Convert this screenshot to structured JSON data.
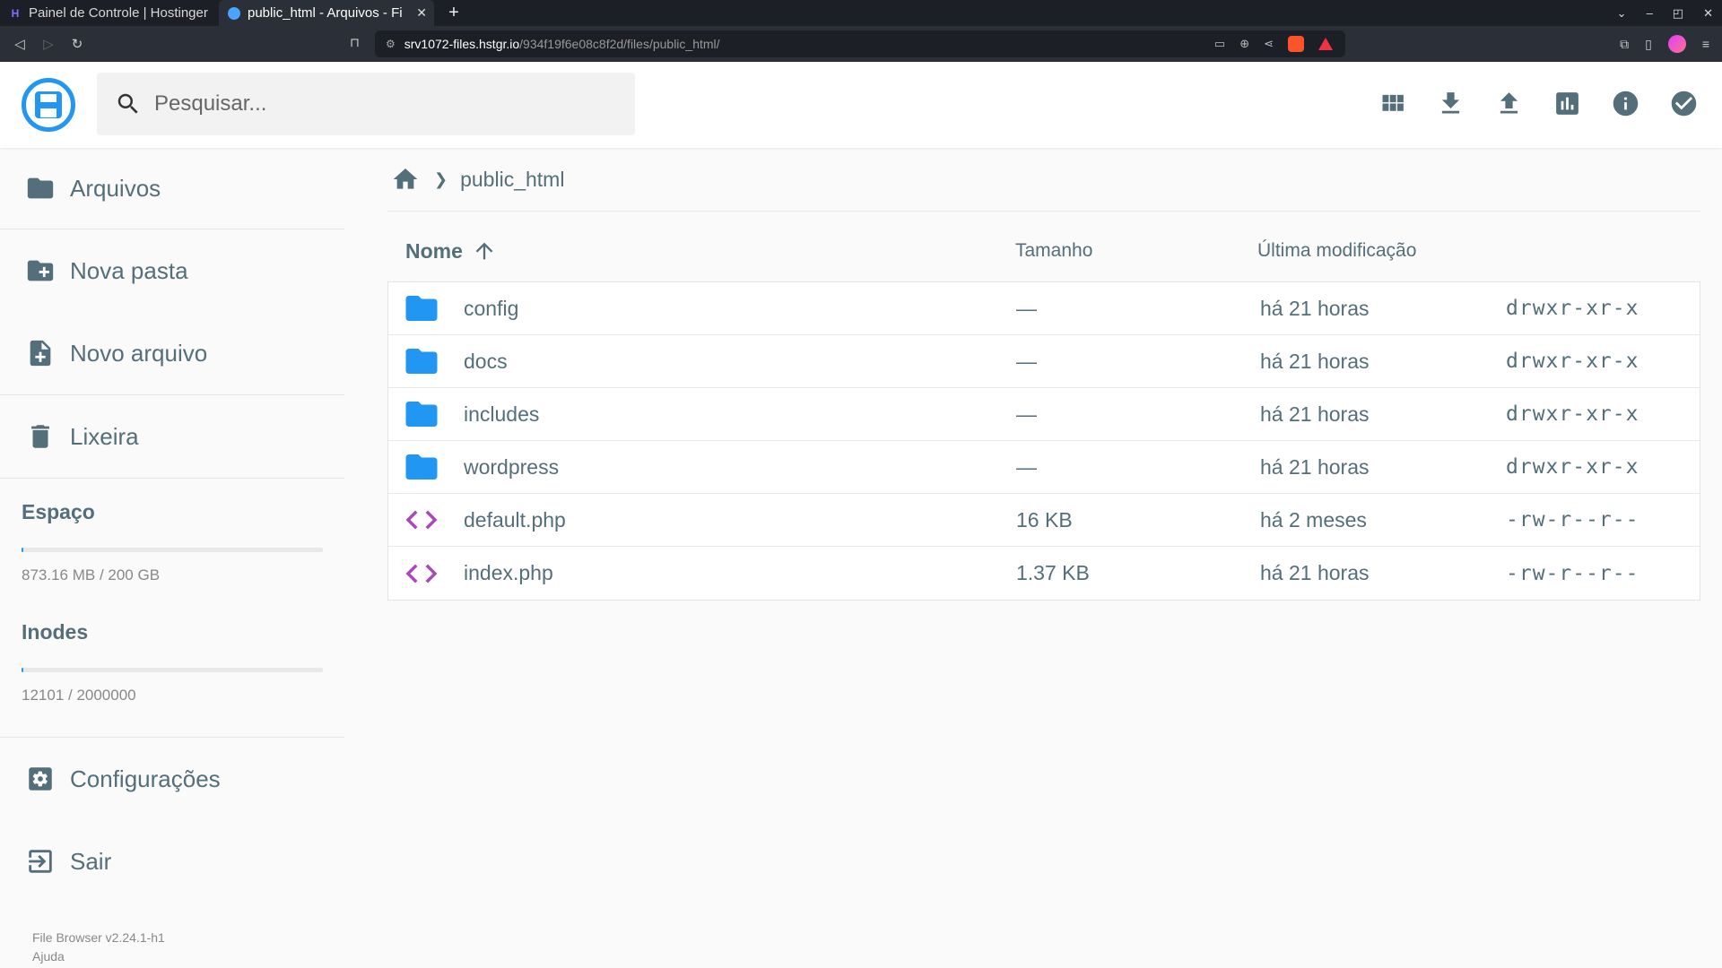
{
  "browser": {
    "tabs": [
      {
        "title": "Painel de Controle | Hostinger",
        "active": false
      },
      {
        "title": "public_html - Arquivos - Fi",
        "active": true
      }
    ],
    "url_host": "srv1072-files.hstgr.io",
    "url_path": "/934f19f6e08c8f2d/files/public_html/"
  },
  "header": {
    "search_placeholder": "Pesquisar...",
    "actions": [
      "grid-view-icon",
      "download-icon",
      "upload-icon",
      "disk-usage-icon",
      "info-icon",
      "select-multiple-icon"
    ]
  },
  "sidebar": {
    "items": [
      {
        "label": "Arquivos",
        "icon": "folder-icon"
      },
      {
        "label": "Nova pasta",
        "icon": "create-folder-icon"
      },
      {
        "label": "Novo arquivo",
        "icon": "new-file-icon"
      },
      {
        "label": "Lixeira",
        "icon": "trash-icon"
      }
    ],
    "space_label": "Espaço",
    "space_value": "873.16 MB / 200 GB",
    "space_fraction": 0.004,
    "inodes_label": "Inodes",
    "inodes_value": "12101 / 2000000",
    "inodes_fraction": 0.006,
    "settings_label": "Configurações",
    "logout_label": "Sair",
    "version": "File Browser v2.24.1-h1",
    "help": "Ajuda"
  },
  "breadcrumb": {
    "current": "public_html"
  },
  "listing": {
    "headers": {
      "name": "Nome",
      "size": "Tamanho",
      "modified": "Última modificação"
    },
    "rows": [
      {
        "name": "config",
        "size": "—",
        "modified": "há 21 horas",
        "perm": "drwxr-xr-x",
        "type": "folder"
      },
      {
        "name": "docs",
        "size": "—",
        "modified": "há 21 horas",
        "perm": "drwxr-xr-x",
        "type": "folder"
      },
      {
        "name": "includes",
        "size": "—",
        "modified": "há 21 horas",
        "perm": "drwxr-xr-x",
        "type": "folder"
      },
      {
        "name": "wordpress",
        "size": "—",
        "modified": "há 21 horas",
        "perm": "drwxr-xr-x",
        "type": "folder"
      },
      {
        "name": "default.php",
        "size": "16 KB",
        "modified": "há 2 meses",
        "perm": "-rw-r--r--",
        "type": "code"
      },
      {
        "name": "index.php",
        "size": "1.37 KB",
        "modified": "há 21 horas",
        "perm": "-rw-r--r--",
        "type": "code"
      }
    ]
  },
  "colors": {
    "accent": "#2196f3",
    "folder": "#2196f3",
    "code": "#ab47bc",
    "text": "#546e7a"
  }
}
